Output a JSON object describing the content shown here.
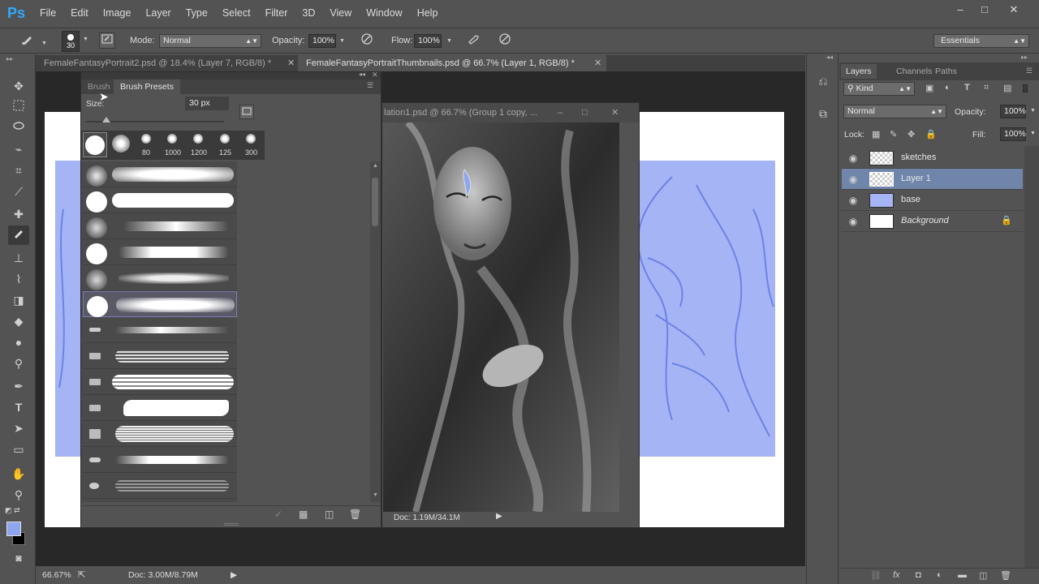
{
  "app": {
    "logo": "Ps"
  },
  "menu": [
    "File",
    "Edit",
    "Image",
    "Layer",
    "Type",
    "Select",
    "Filter",
    "3D",
    "View",
    "Window",
    "Help"
  ],
  "window_controls": {
    "minimize": "–",
    "restore": "□",
    "close": "✕"
  },
  "options_bar": {
    "brush_size": "30",
    "mode_label": "Mode:",
    "mode_value": "Normal",
    "opacity_label": "Opacity:",
    "opacity_value": "100%",
    "flow_label": "Flow:",
    "flow_value": "100%",
    "workspace": "Essentials"
  },
  "tabs": [
    {
      "label": "FemaleFantasyPortrait2.psd @ 18.4% (Layer 7, RGB/8) *",
      "close": "✕"
    },
    {
      "label": "FemaleFantasyPortraitThumbnails.psd @ 66.7% (Layer 1, RGB/8) *",
      "close": "✕"
    }
  ],
  "brush_panel": {
    "tabs": [
      "Brush",
      "Brush Presets"
    ],
    "size_label": "Size:",
    "size_value": "30 px",
    "quick_sizes": [
      "80",
      "1000",
      "1200",
      "125",
      "300"
    ]
  },
  "floating_doc": {
    "title": "lation1.psd @ 66.7% (Group 1 copy, ...",
    "status": "Doc: 1.19M/34.1M"
  },
  "layers_panel": {
    "tabs": [
      "Layers",
      "Channels",
      "Paths"
    ],
    "filter": "Kind",
    "blend_mode": "Normal",
    "opacity_label": "Opacity:",
    "opacity_value": "100%",
    "lock_label": "Lock:",
    "fill_label": "Fill:",
    "fill_value": "100%",
    "layers": [
      {
        "name": "sketches",
        "selected": false,
        "locked": false
      },
      {
        "name": "Layer 1",
        "selected": true,
        "locked": false
      },
      {
        "name": "base",
        "selected": false,
        "locked": false
      },
      {
        "name": "Background",
        "selected": false,
        "locked": true
      }
    ]
  },
  "status": {
    "zoom": "66.67%",
    "doc": "Doc: 3.00M/8.79M"
  },
  "colors": {
    "foreground": "#8ea6f0",
    "background": "#000000",
    "accent": "#31a8ff"
  }
}
